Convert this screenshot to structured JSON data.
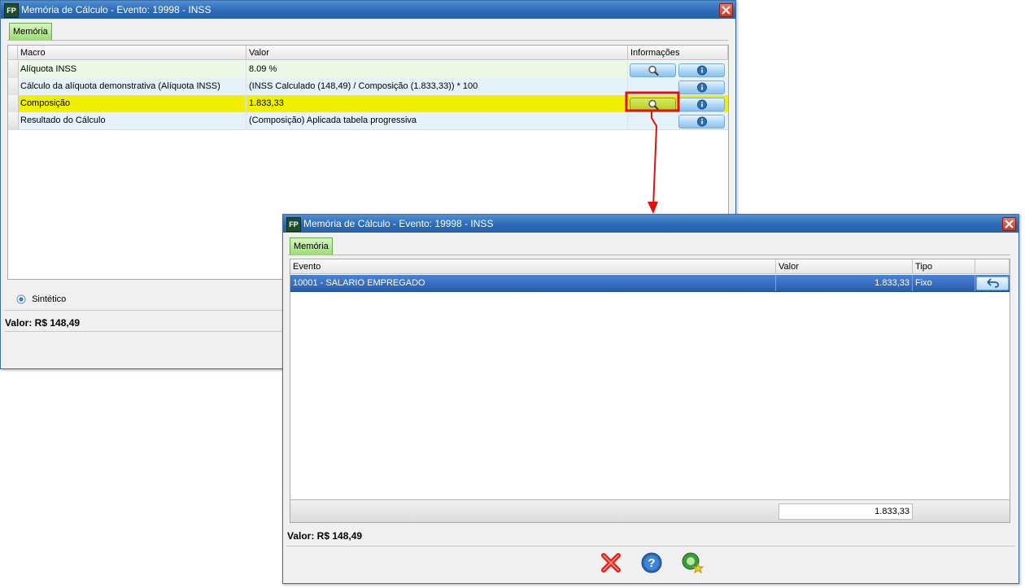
{
  "window1": {
    "title": "Memória de Cálculo - Evento: 19998 - INSS",
    "tab_label": "Memória",
    "columns": [
      "Macro",
      "Valor",
      "Informações"
    ],
    "rows": [
      {
        "macro": "Alíquota INSS",
        "valor": "8.09 %"
      },
      {
        "macro": "Cálculo da alíquota demonstrativa (Alíquota INSS)",
        "valor": "(INSS Calculado (148,49) / Composição (1.833,33)) * 100"
      },
      {
        "macro": "Composição",
        "valor": "1.833,33"
      },
      {
        "macro": "Resultado do Cálculo",
        "valor": "(Composição) Aplicada tabela progressiva"
      }
    ],
    "radio_label": "Sintético",
    "status_text": "Valor: R$ 148,49"
  },
  "window2": {
    "title": "Memória de Cálculo - Evento: 19998 - INSS",
    "tab_label": "Memória",
    "columns": [
      "Evento",
      "Valor",
      "Tipo"
    ],
    "rows": [
      {
        "evento": "10001 - SALARIO EMPREGADO",
        "valor": "1.833,33",
        "tipo": "Fixo"
      }
    ],
    "total": "1.833,33",
    "status_text": "Valor: R$ 148,49"
  },
  "colors": {
    "title_bar": "#2d6bb6",
    "highlight_row": "#f0f000",
    "selected_row": "#2f63b8",
    "annotation": "#e01010",
    "row_alt_green": "#eef8e6",
    "row_alt_blue": "#e6f2fa"
  }
}
